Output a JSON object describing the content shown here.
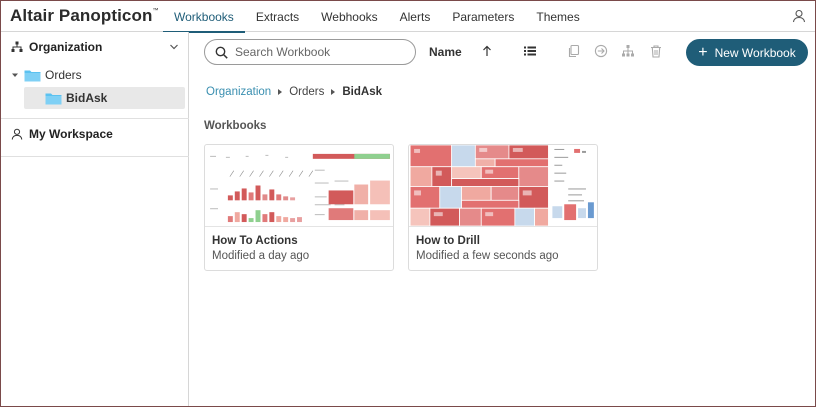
{
  "app": {
    "brand": "Altair Panopticon",
    "brand_tm": "™"
  },
  "nav": {
    "tabs": [
      {
        "label": "Workbooks",
        "active": true
      },
      {
        "label": "Extracts"
      },
      {
        "label": "Webhooks"
      },
      {
        "label": "Alerts"
      },
      {
        "label": "Parameters"
      },
      {
        "label": "Themes"
      }
    ]
  },
  "sidebar": {
    "organization_label": "Organization",
    "tree": [
      {
        "label": "Orders",
        "expanded": true
      },
      {
        "label": "BidAsk",
        "selected": true
      }
    ],
    "workspace_label": "My Workspace"
  },
  "toolbar": {
    "search_placeholder": "Search Workbook",
    "sort_label": "Name",
    "new_button_label": "New Workbook"
  },
  "breadcrumb": {
    "items": [
      "Organization",
      "Orders",
      "BidAsk"
    ]
  },
  "section_title": "Workbooks",
  "workbooks": [
    {
      "title": "How To Actions",
      "modified": "Modified a day ago"
    },
    {
      "title": "How to Drill",
      "modified": "Modified a few seconds ago"
    }
  ],
  "colors": {
    "accent": "#1f5d78",
    "link": "#3a8fb0",
    "folder": "#5bc2f0",
    "chart_red": "#d25a5a",
    "chart_pink": "#f0a9a0",
    "chart_green": "#8fd08f"
  }
}
